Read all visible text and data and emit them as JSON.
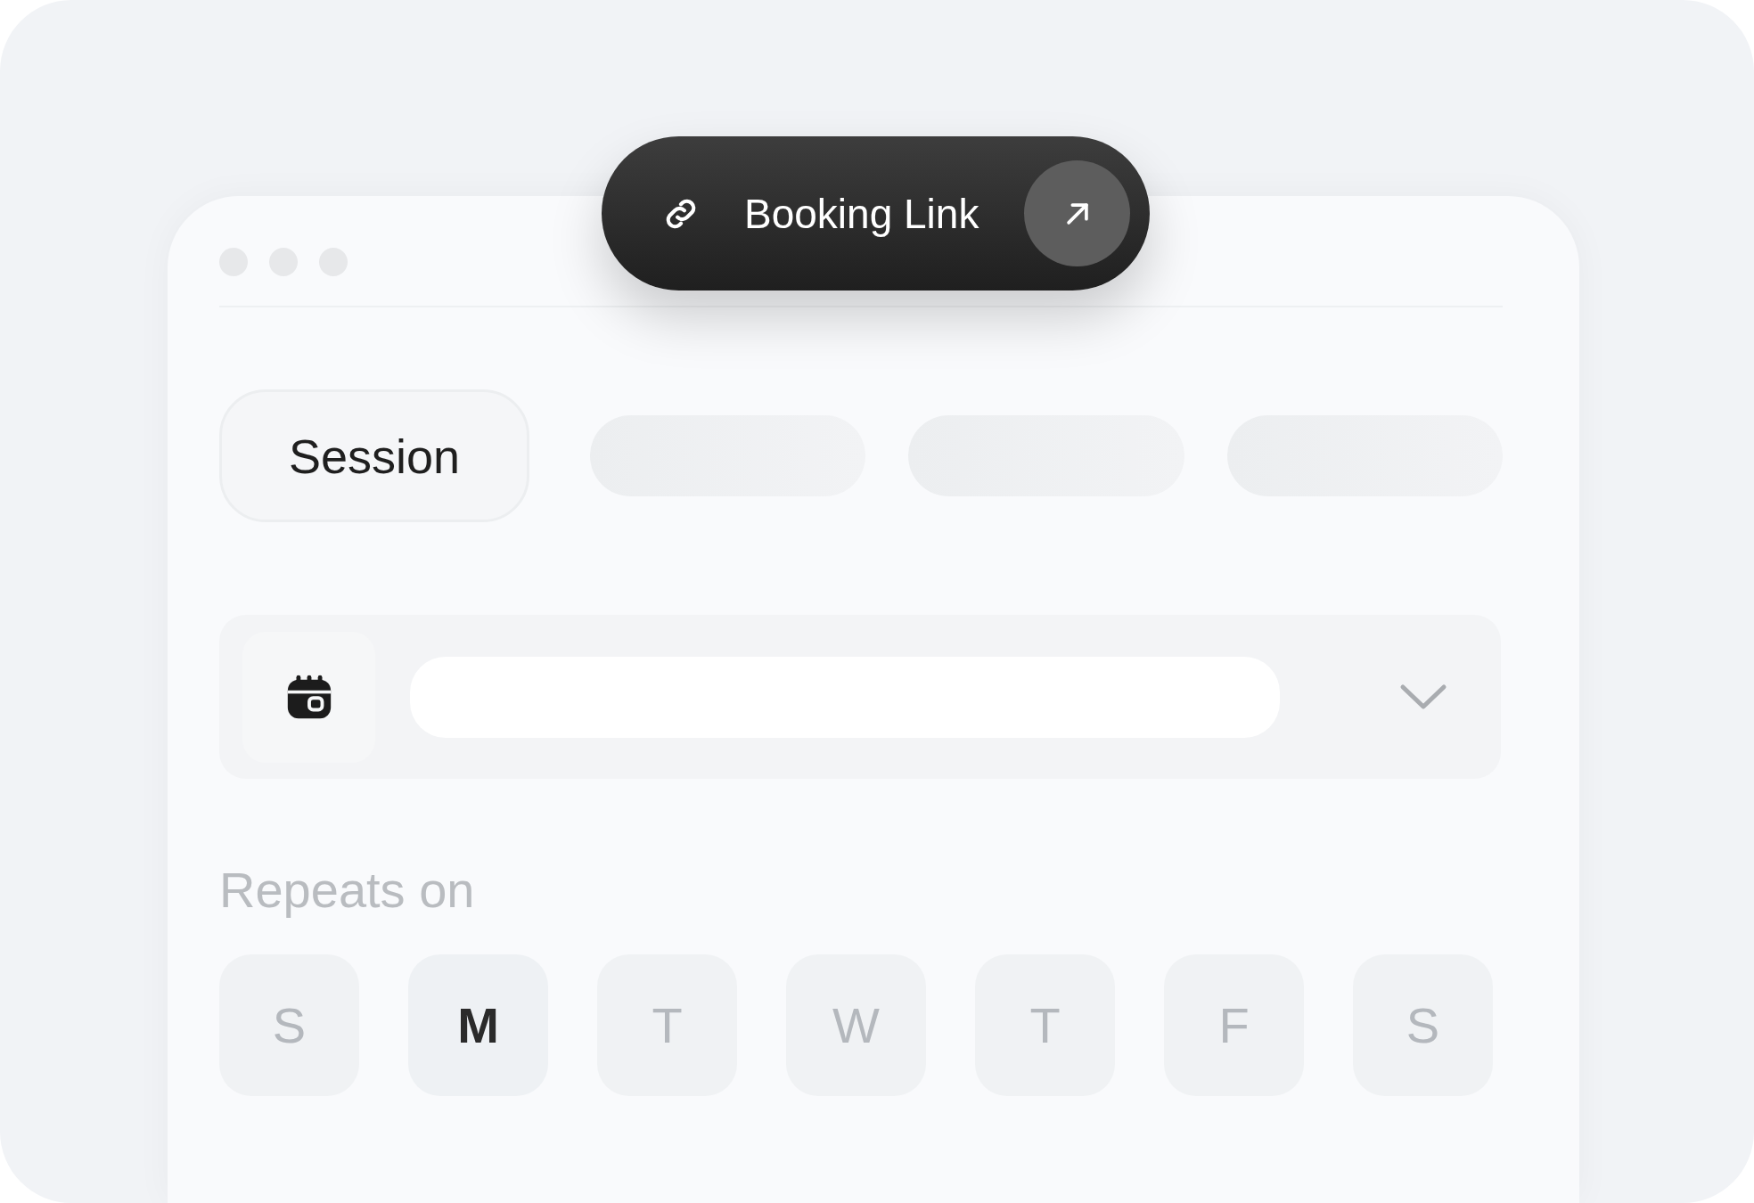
{
  "booking_link": {
    "label": "Booking Link"
  },
  "tabs": [
    {
      "label": "Session",
      "selected": true
    },
    {
      "selected": false
    },
    {
      "selected": false
    },
    {
      "selected": false
    }
  ],
  "repeats": {
    "label": "Repeats on"
  },
  "days": [
    {
      "label": "S",
      "selected": false
    },
    {
      "label": "M",
      "selected": true
    },
    {
      "label": "T",
      "selected": false
    },
    {
      "label": "W",
      "selected": false
    },
    {
      "label": "T",
      "selected": false
    },
    {
      "label": "F",
      "selected": false
    },
    {
      "label": "S",
      "selected": false
    }
  ]
}
